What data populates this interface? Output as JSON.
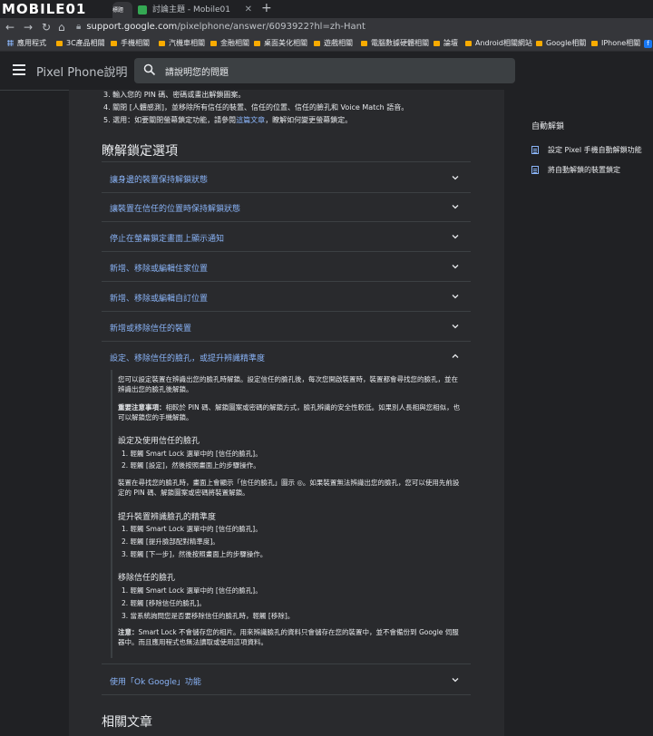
{
  "browser": {
    "site_logo": "MOBILE01",
    "tabs": [
      {
        "title": "標題",
        "active": true
      },
      {
        "title": "討論主題 - Mobile01",
        "active": false
      }
    ],
    "new_tab": "+",
    "address_bar": {
      "host": "support.google.com",
      "path": "/pixelphone/answer/6093922?hl=zh-Hant"
    },
    "bookmarks": [
      {
        "label": "應用程式",
        "icon": "apps-icon"
      },
      {
        "label": "3C產品相關",
        "icon": "folder-icon"
      },
      {
        "label": "手機相關",
        "icon": "folder-icon"
      },
      {
        "label": "汽機車相關",
        "icon": "folder-icon"
      },
      {
        "label": "金融相關",
        "icon": "folder-icon"
      },
      {
        "label": "桌面美化相關",
        "icon": "folder-icon"
      },
      {
        "label": "遊戲相關",
        "icon": "folder-icon"
      },
      {
        "label": "電腦數據硬體相關",
        "icon": "folder-icon"
      },
      {
        "label": "論壇",
        "icon": "folder-icon"
      },
      {
        "label": "Android相關網站",
        "icon": "folder-icon"
      },
      {
        "label": "Google相關",
        "icon": "folder-icon"
      },
      {
        "label": "IPhone相關",
        "icon": "folder-icon"
      }
    ]
  },
  "header": {
    "site_title": "Pixel Phone說明",
    "search_placeholder": "請說明您的問題"
  },
  "steps": {
    "s3": "3. 輸入您的 PIN 碼、密碼或畫出解鎖圖案。",
    "s4": "4. 關閉 [人體感測]，並移除所有信任的裝置、信任的位置、信任的臉孔和 Voice Match 語音。",
    "s5_pre": "5. 選用：如要關閉螢幕鎖定功能，請參閱",
    "s5_link": "這篇文章",
    "s5_post": "，瞭解如何變更螢幕鎖定。"
  },
  "section_title": "瞭解鎖定選項",
  "accordion": [
    {
      "label": "讓身邊的裝置保持解鎖狀態",
      "expanded": false
    },
    {
      "label": "讓裝置在信任的位置時保持解鎖狀態",
      "expanded": false
    },
    {
      "label": "停止在螢幕鎖定畫面上顯示通知",
      "expanded": false
    },
    {
      "label": "新增、移除或編輯住家位置",
      "expanded": false
    },
    {
      "label": "新增、移除或編輯自訂位置",
      "expanded": false
    },
    {
      "label": "新增或移除信任的裝置",
      "expanded": false
    },
    {
      "label": "設定、移除信任的臉孔，或提升辨識精準度",
      "expanded": true
    },
    {
      "label": "使用「Ok Google」功能",
      "expanded": false
    }
  ],
  "expanded_content": {
    "intro": "您可以設定裝置在辨識出您的臉孔時解鎖。設定信任的臉孔後，每次您開啟裝置時，裝置都會尋找您的臉孔，並在辨識出您的臉孔後解鎖。",
    "important_label": "重要注意事項：",
    "important_text": "相較於 PIN 碼、解鎖圖案或密碼的解鎖方式，臉孔辨識的安全性較低。如果別人長相與您相似，也可以解鎖您的手機解鎖。",
    "h1": "設定及使用信任的臉孔",
    "h1_items": [
      "1. 輕觸 Smart Lock 選單中的 [信任的臉孔]。",
      "2. 輕觸 [設定]，然後按照畫面上的步驟操作。"
    ],
    "h1_note": "裝置在尋找您的臉孔時，畫面上會顯示「信任的臉孔」圖示 ◎。如果裝置無法辨識出您的臉孔，您可以使用先前設定的 PIN 碼、解鎖圖案或密碼將裝置解鎖。",
    "h2": "提升裝置辨識臉孔的精準度",
    "h2_items": [
      "1. 輕觸 Smart Lock 選單中的 [信任的臉孔]。",
      "2. 輕觸 [提升臉部配對精準度]。",
      "3. 輕觸 [下一步]，然後按照畫面上的步驟操作。"
    ],
    "h3": "移除信任的臉孔",
    "h3_items": [
      "1. 輕觸 Smart Lock 選單中的 [信任的臉孔]。",
      "2. 輕觸 [移除信任的臉孔]。",
      "3. 當系統詢問您是否要移除信任的臉孔時，輕觸 [移除]。"
    ],
    "note_label": "注意：",
    "note_text": "Smart Lock 不會儲存您的相片。用來辨識臉孔的資料只會儲存在您的裝置中，並不會備份到 Google 伺服器中。而且應用程式也無法讀取或使用這項資料。"
  },
  "related_title": "相關文章",
  "toc": {
    "title": "自動解鎖",
    "items": [
      {
        "label": "設定 Pixel 手機自動解鎖功能",
        "active": true
      },
      {
        "label": "將自動解鎖的裝置鎖定",
        "active": false
      }
    ]
  },
  "colors": {
    "accent_link": "#8ab4f8",
    "background": "#202124",
    "content_bg": "#292a2d"
  }
}
